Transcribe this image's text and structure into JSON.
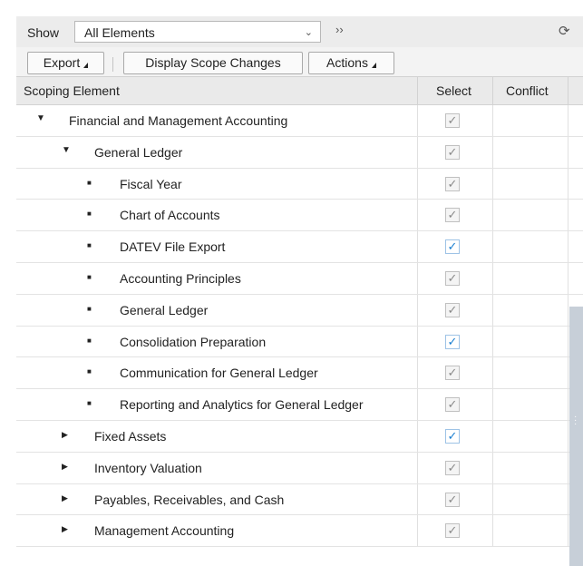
{
  "toolbar": {
    "show_label": "Show",
    "filter_value": "All Elements",
    "more_label": "››",
    "refresh_icon": "refresh-icon"
  },
  "actions": {
    "export_label": "Export",
    "display_scope_label": "Display Scope Changes",
    "actions_label": "Actions"
  },
  "table": {
    "headers": {
      "element": "Scoping Element",
      "select": "Select",
      "conflict": "Conflict"
    },
    "rows": [
      {
        "label": "Financial and Management Accounting",
        "level": 0,
        "indicator": "expanded",
        "checked_color": "gray"
      },
      {
        "label": "General Ledger",
        "level": 1,
        "indicator": "expanded",
        "checked_color": "gray"
      },
      {
        "label": "Fiscal Year",
        "level": 2,
        "indicator": "leaf",
        "checked_color": "gray"
      },
      {
        "label": "Chart of Accounts",
        "level": 2,
        "indicator": "leaf",
        "checked_color": "gray"
      },
      {
        "label": "DATEV File Export",
        "level": 2,
        "indicator": "leaf",
        "checked_color": "blue"
      },
      {
        "label": "Accounting Principles",
        "level": 2,
        "indicator": "leaf",
        "checked_color": "gray"
      },
      {
        "label": "General Ledger",
        "level": 2,
        "indicator": "leaf",
        "checked_color": "gray"
      },
      {
        "label": "Consolidation Preparation",
        "level": 2,
        "indicator": "leaf",
        "checked_color": "blue"
      },
      {
        "label": "Communication for General Ledger",
        "level": 2,
        "indicator": "leaf",
        "checked_color": "gray"
      },
      {
        "label": "Reporting and Analytics for General Ledger",
        "level": 2,
        "indicator": "leaf",
        "checked_color": "gray"
      },
      {
        "label": "Fixed Assets",
        "level": 1,
        "indicator": "collapsed",
        "checked_color": "blue"
      },
      {
        "label": "Inventory Valuation",
        "level": 1,
        "indicator": "collapsed",
        "checked_color": "gray"
      },
      {
        "label": "Payables, Receivables, and Cash",
        "level": 1,
        "indicator": "collapsed",
        "checked_color": "gray"
      },
      {
        "label": "Management Accounting",
        "level": 1,
        "indicator": "collapsed",
        "checked_color": "gray"
      }
    ]
  },
  "colors": {
    "checked_gray": "#8a8a8a",
    "checked_blue": "#1a7fd1"
  }
}
